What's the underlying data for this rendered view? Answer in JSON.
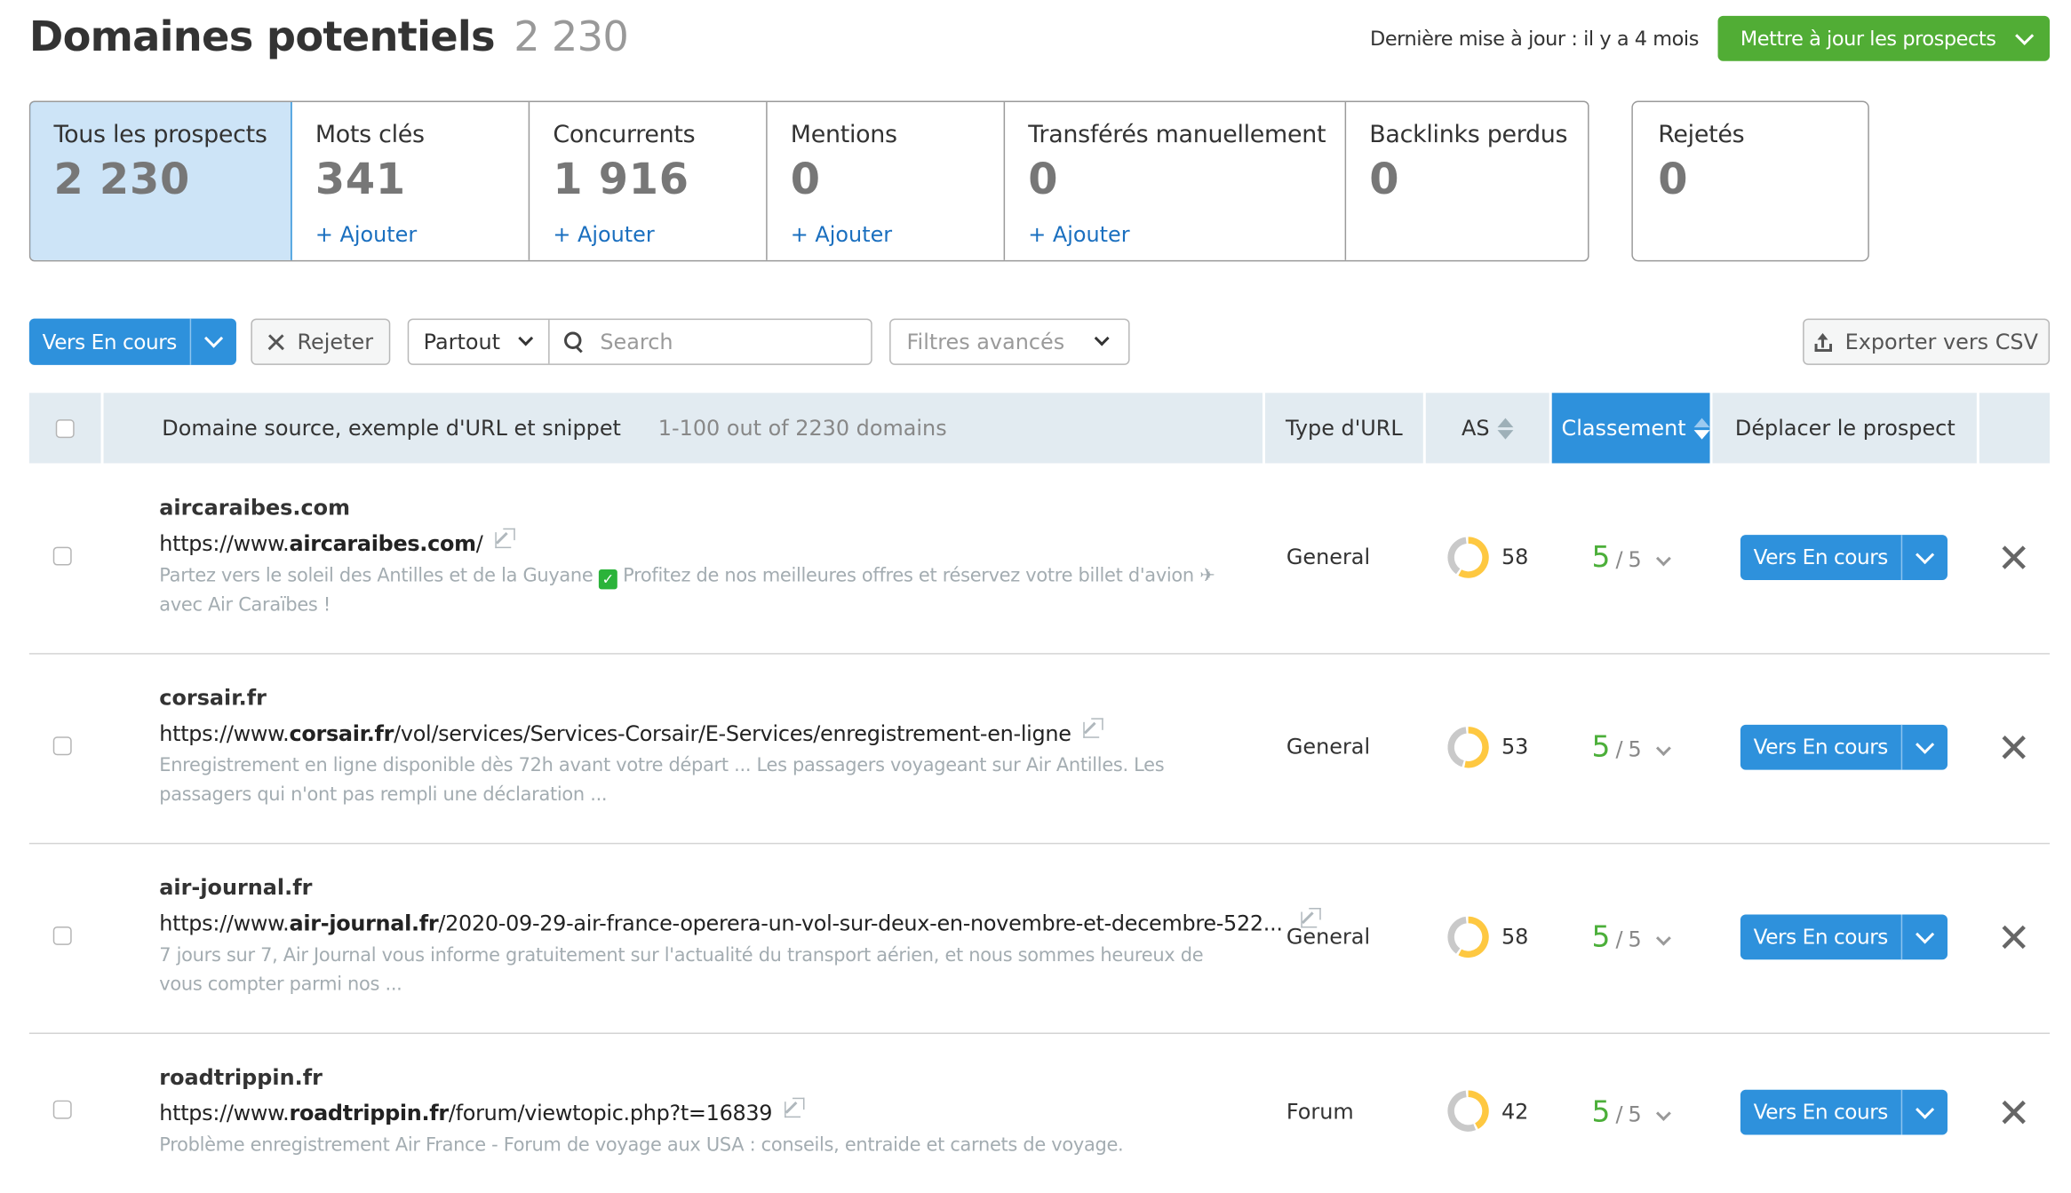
{
  "header": {
    "title": "Domaines potentiels",
    "title_count": "2 230",
    "last_update": "Dernière mise à jour : il y a 4 mois",
    "update_button": "Mettre à jour les prospects"
  },
  "tabs": [
    {
      "label": "Tous les prospects",
      "value": "2 230",
      "add": null,
      "active": true
    },
    {
      "label": "Mots clés",
      "value": "341",
      "add": "+ Ajouter"
    },
    {
      "label": "Concurrents",
      "value": "1 916",
      "add": "+ Ajouter"
    },
    {
      "label": "Mentions",
      "value": "0",
      "add": "+ Ajouter"
    },
    {
      "label": "Transférés manuellement",
      "value": "0",
      "add": "+ Ajouter"
    },
    {
      "label": "Backlinks perdus",
      "value": "0",
      "add": null
    }
  ],
  "rejected_tab": {
    "label": "Rejetés",
    "value": "0"
  },
  "toolbar": {
    "move_button": "Vers En cours",
    "reject_button": "Rejeter",
    "scope_select": "Partout",
    "search_placeholder": "Search",
    "search_value": "",
    "advanced_filters": "Filtres avancés",
    "export_button": "Exporter vers CSV"
  },
  "table": {
    "columns": {
      "source": "Domaine source, exemple d'URL et snippet",
      "pager": "1-100 out of 2230 domains",
      "url_type": "Type d'URL",
      "as": "AS",
      "ranking": "Classement",
      "move": "Déplacer le prospect"
    },
    "rows": [
      {
        "domain": "aircaraibes.com",
        "url_prefix": "https://www.",
        "url_domain": "aircaraibes.com",
        "url_path": "/",
        "snippet_a": "Partez vers le soleil des Antilles et de la Guyane",
        "snippet_emoji": "✓",
        "snippet_b": "Profitez de nos meilleures offres et réservez votre billet d'avion ✈ avec Air Caraïbes !",
        "url_type": "General",
        "as": 58,
        "rank": "5",
        "rank_max": "5",
        "move": "Vers En cours"
      },
      {
        "domain": "corsair.fr",
        "url_prefix": "https://www.",
        "url_domain": "corsair.fr",
        "url_path": "/vol/services/Services-Corsair/E-Services/enregistrement-en-ligne",
        "snippet_a": "Enregistrement en ligne disponible dès 72h avant votre départ ... Les passagers voyageant sur Air Antilles. Les passagers qui n'ont pas rempli une déclaration ...",
        "snippet_emoji": null,
        "snippet_b": "",
        "url_type": "General",
        "as": 53,
        "rank": "5",
        "rank_max": "5",
        "move": "Vers En cours"
      },
      {
        "domain": "air-journal.fr",
        "url_prefix": "https://www.",
        "url_domain": "air-journal.fr",
        "url_path": "/2020-09-29-air-france-operera-un-vol-sur-deux-en-novembre-et-decembre-522...",
        "snippet_a": "7 jours sur 7, Air Journal vous informe gratuitement sur l'actualité du transport aérien, et nous sommes heureux de vous compter parmi nos ...",
        "snippet_emoji": null,
        "snippet_b": "",
        "url_type": "General",
        "as": 58,
        "rank": "5",
        "rank_max": "5",
        "move": "Vers En cours"
      },
      {
        "domain": "roadtrippin.fr",
        "url_prefix": "https://www.",
        "url_domain": "roadtrippin.fr",
        "url_path": "/forum/viewtopic.php?t=16839",
        "snippet_a": "Problème enregistrement Air France - Forum de voyage aux USA : conseils, entraide et carnets de voyage.",
        "snippet_emoji": null,
        "snippet_b": "",
        "url_type": "Forum",
        "as": 42,
        "rank": "5",
        "rank_max": "5",
        "move": "Vers En cours"
      }
    ]
  },
  "colors": {
    "primary": "#2e91dc",
    "success": "#51ad35",
    "rank_green": "#4caf3a",
    "donut_fill": "#fec841",
    "donut_track": "#c9c9c9",
    "active_tab_bg": "#cde4f7",
    "header_bg": "#e2ebf1"
  }
}
